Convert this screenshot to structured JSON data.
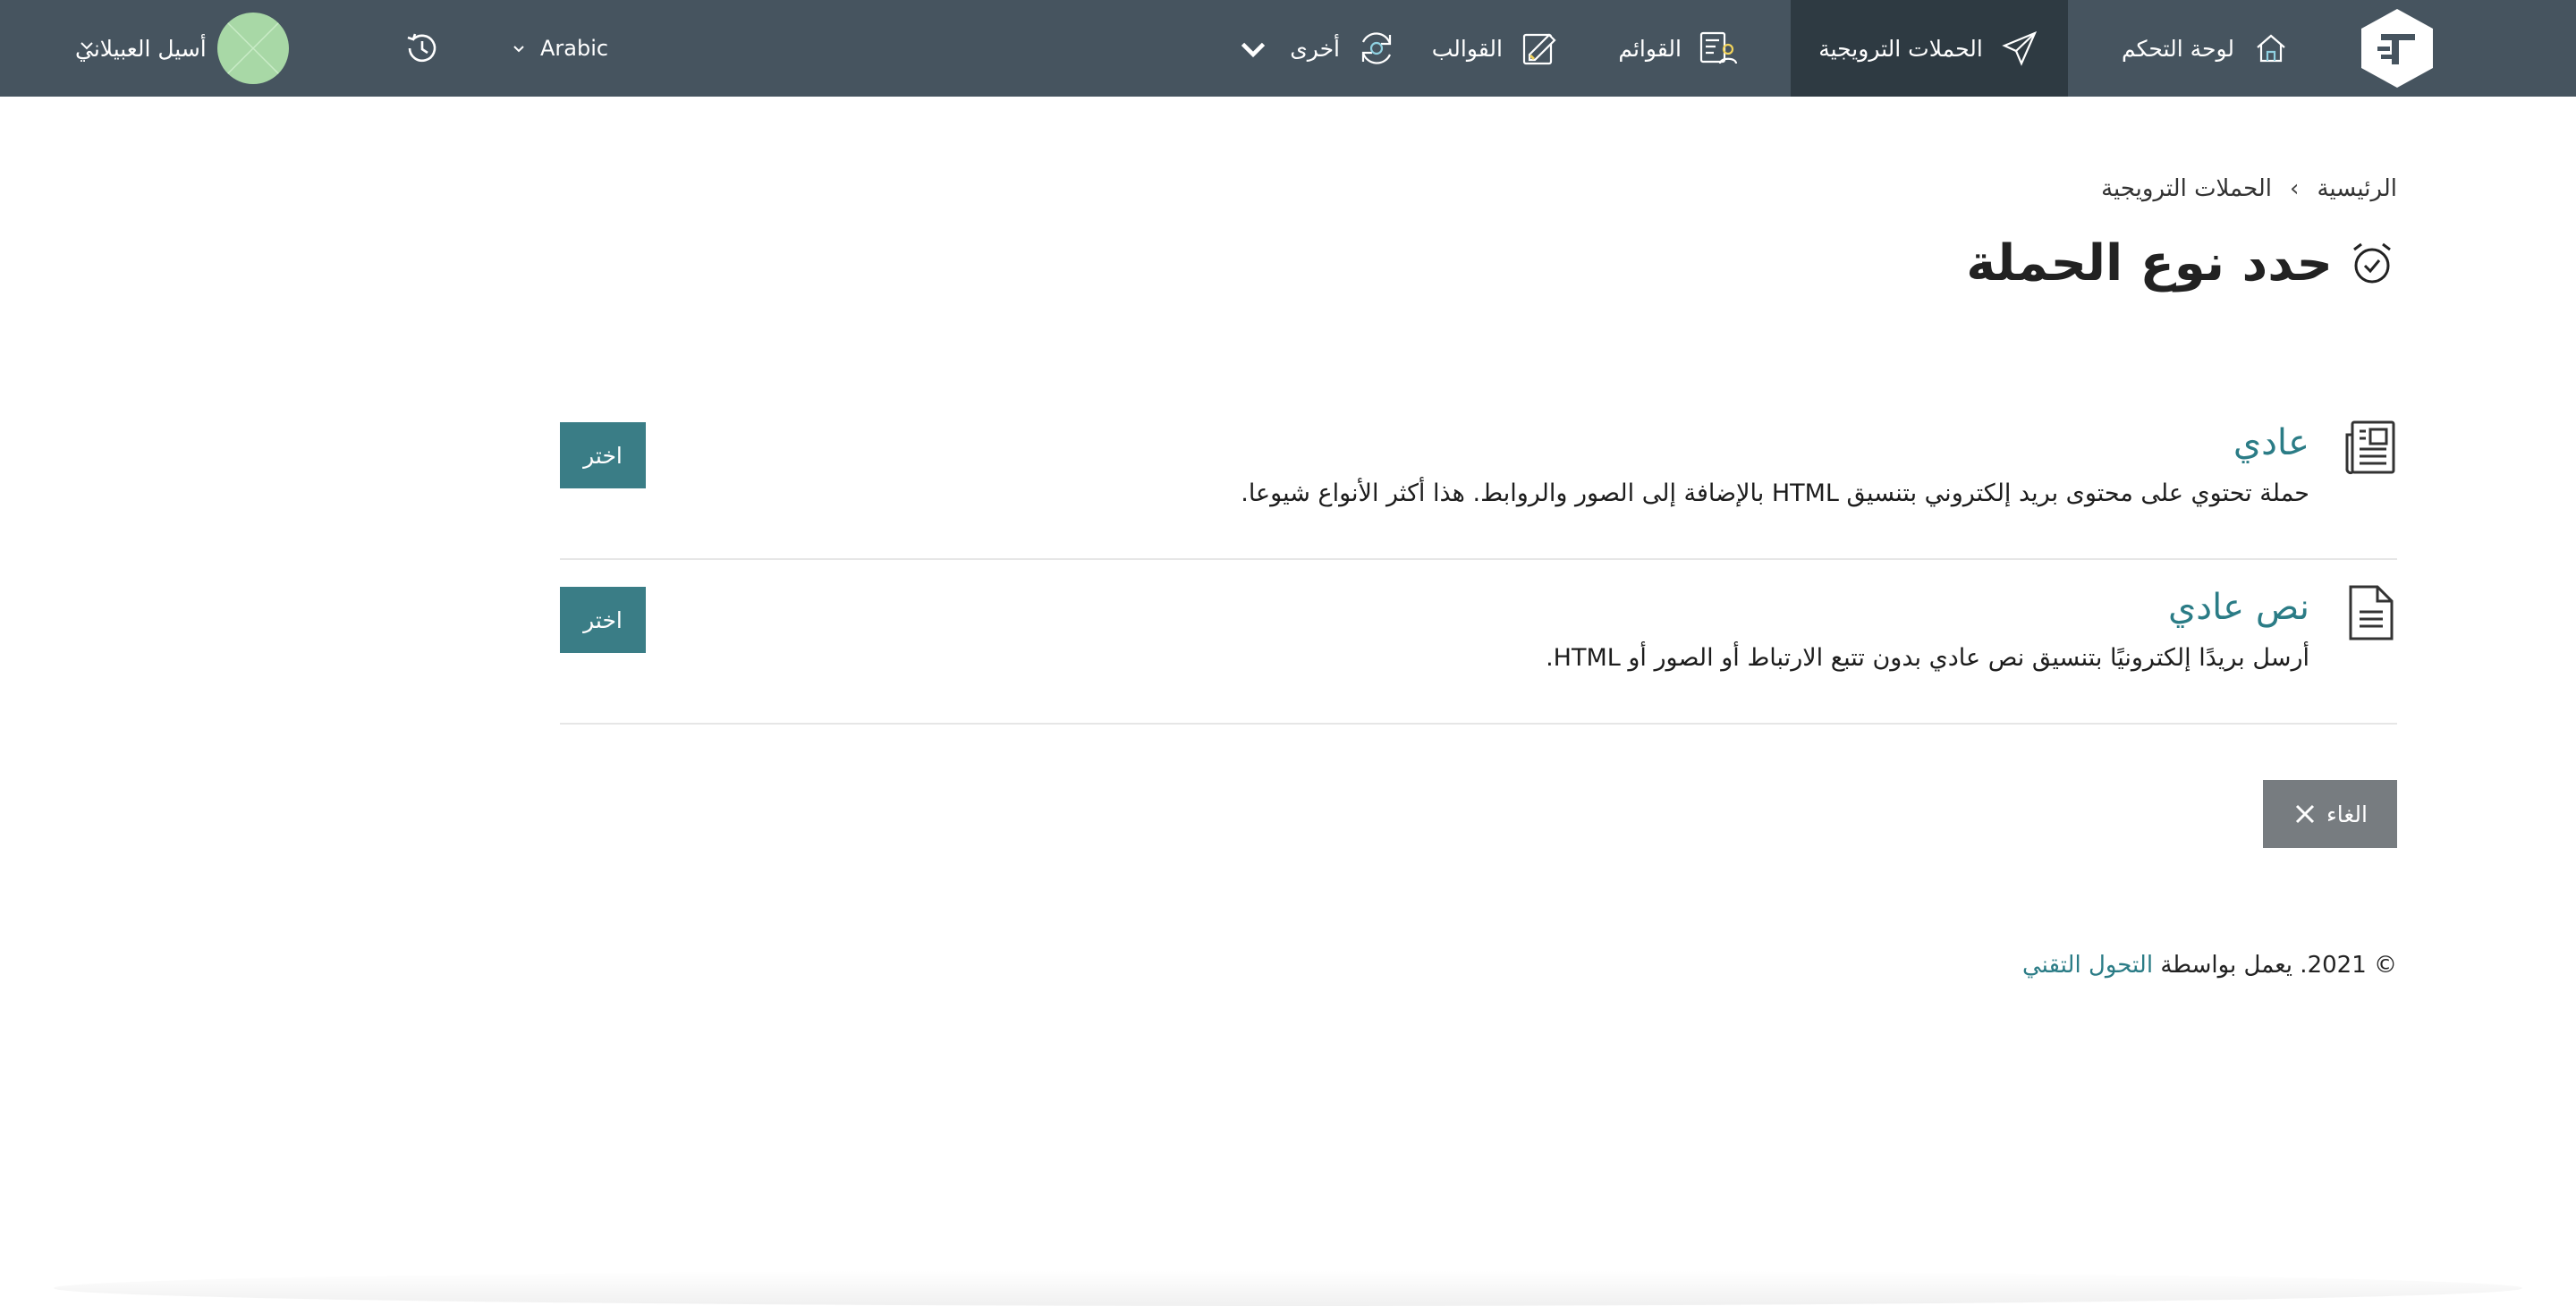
{
  "nav": {
    "dashboard": "لوحة التحكم",
    "campaigns": "الحملات الترويجية",
    "lists": "القوائم",
    "templates": "القوالب",
    "other": "أخرى",
    "language": "Arabic",
    "user_name": "أسيل العبيلاني"
  },
  "breadcrumb": {
    "home": "الرئيسية",
    "separator": "›",
    "current": "الحملات الترويجية"
  },
  "page": {
    "title": "حدد نوع الحملة"
  },
  "campaign_types": [
    {
      "title": "عادي",
      "description": "حملة تحتوي على محتوى بريد إلكتروني بتنسيق HTML بالإضافة إلى الصور والروابط. هذا أكثر الأنواع شيوعا.",
      "button": "اختر",
      "icon": "newspaper-icon"
    },
    {
      "title": "نص عادي",
      "description": "أرسل بريدًا إلكترونيًا بتنسيق نص عادي بدون تتبع الارتباط أو الصور أو HTML.",
      "button": "اختر",
      "icon": "document-text-icon"
    }
  ],
  "cancel_label": "الغاء",
  "footer": {
    "text": "© 2021. يعمل بواسطة",
    "link": "التحول التقني"
  },
  "colors": {
    "navbar": "#46545f",
    "navbar_active": "#2e3a42",
    "accent": "#2b7c86",
    "select_button": "#3a7d86",
    "cancel_button": "#777c80",
    "avatar": "#a8d8a6"
  }
}
